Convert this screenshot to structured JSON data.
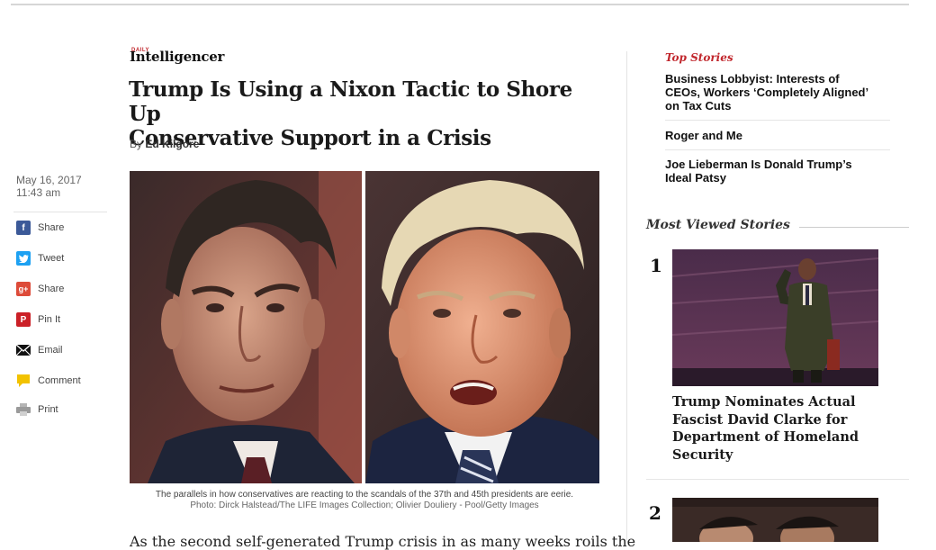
{
  "brand": {
    "small": "DAILY",
    "name": "Intelligencer"
  },
  "article": {
    "headline_line1": "Trump Is Using a Nixon Tactic to Shore Up",
    "headline_line2": "Conservative Support in a Crisis",
    "byline_prefix": "By",
    "author": "Ed Kilgore",
    "date": "May 16, 2017",
    "time": "11:43 am",
    "caption": "The parallels in how conservatives are reacting to the scandals of the 37th and 45th presidents are eerie.",
    "credit": "Photo: Dirck Halstead/The LIFE Images Collection; Olivier Douliery - Pool/Getty Images",
    "body_start": "As the second self-generated Trump crisis in as many weeks roils the"
  },
  "share": [
    {
      "label": "Share",
      "icon": "facebook-icon",
      "glyph": "f",
      "color": "#3b5998"
    },
    {
      "label": "Tweet",
      "icon": "twitter-icon",
      "glyph": "t",
      "color": "#1da1f2"
    },
    {
      "label": "Share",
      "icon": "google-plus-icon",
      "glyph": "g+",
      "color": "#dd4b39"
    },
    {
      "label": "Pin It",
      "icon": "pinterest-icon",
      "glyph": "P",
      "color": "#cb2027"
    },
    {
      "label": "Email",
      "icon": "email-icon",
      "glyph": "✉",
      "color": "#111111"
    },
    {
      "label": "Comment",
      "icon": "comment-icon",
      "glyph": "",
      "color": "#f2c200"
    },
    {
      "label": "Print",
      "icon": "print-icon",
      "glyph": "",
      "color": "#9a9a9a"
    }
  ],
  "top_stories": {
    "title": "Top Stories",
    "items": [
      {
        "line1": "Business Lobbyist: Interests of",
        "line2": "CEOs, Workers ‘Completely Aligned’",
        "line3": "on Tax Cuts"
      },
      {
        "line1": "Roger and Me"
      },
      {
        "line1": "Joe Lieberman Is Donald Trump’s",
        "line2": "Ideal Patsy"
      }
    ]
  },
  "most_viewed": {
    "title": "Most Viewed Stories",
    "items": [
      {
        "rank": "1",
        "line1": "Trump Nominates Actual",
        "line2": "Fascist David Clarke for",
        "line3": "Department of Homeland",
        "line4": "Security"
      },
      {
        "rank": "2"
      }
    ]
  },
  "colors": {
    "accent": "#c1272d"
  }
}
